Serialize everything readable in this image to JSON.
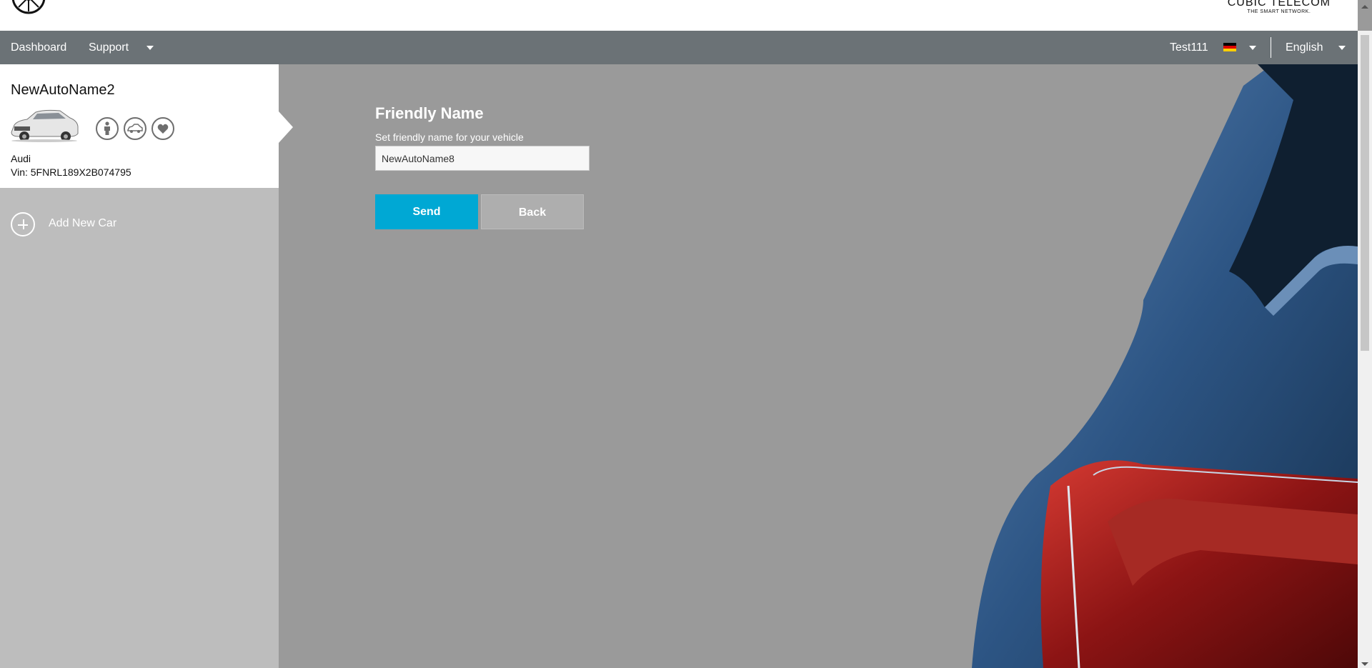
{
  "brand": {
    "line1": "CUBIC TELECOM",
    "line2": "THE SMART NETWORK."
  },
  "nav": {
    "dashboard": "Dashboard",
    "support": "Support",
    "user": "Test111",
    "language": "English"
  },
  "vehicle": {
    "name": "NewAutoName2",
    "make": "Audi",
    "vin": "Vin: 5FNRL189X2B074795",
    "icons": [
      "person-icon",
      "car-icon",
      "heart-icon"
    ]
  },
  "sidebar": {
    "add_car": "Add New Car"
  },
  "form": {
    "title": "Friendly Name",
    "label": "Set friendly name for your vehicle",
    "value": "NewAutoName8",
    "send": "Send",
    "back": "Back"
  },
  "colors": {
    "accent": "#00a8d4",
    "navbar": "#6b7276",
    "sidebar": "#bdbdbd",
    "background": "#9a9a9a"
  }
}
